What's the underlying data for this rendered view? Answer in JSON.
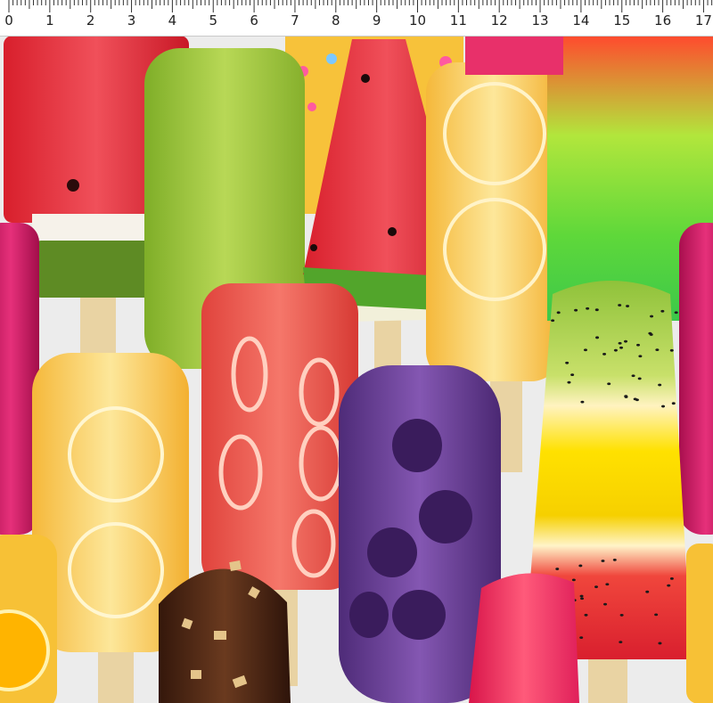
{
  "ruler": {
    "unit_labels": [
      "0",
      "1",
      "2",
      "3",
      "4",
      "5",
      "6",
      "7",
      "8",
      "9",
      "10",
      "11",
      "12",
      "13",
      "14",
      "15",
      "16",
      "17"
    ]
  },
  "scene": {
    "subject": "popsicles-pattern",
    "colors": {
      "watermelon_red": "#e8343f",
      "kiwi_green": "#9cc63a",
      "lemon_yellow": "#f9c84a",
      "strawberry": "#ee5a4e",
      "grape_purple": "#6c3c97",
      "chocolate": "#4a2514",
      "lime": "#7ed84a",
      "magenta": "#c8155f"
    }
  }
}
